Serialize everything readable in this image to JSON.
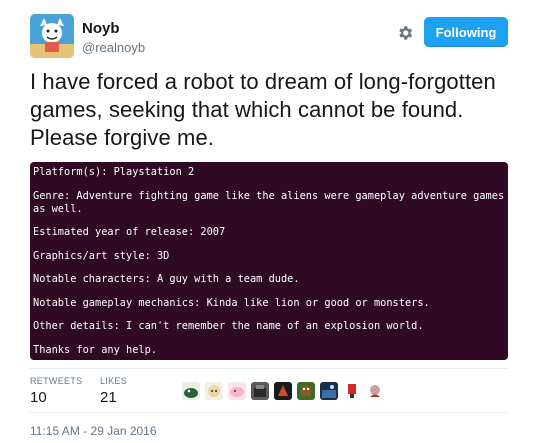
{
  "account": {
    "display_name": "Noyb",
    "handle": "@realnoyb"
  },
  "follow_button": {
    "label": "Following"
  },
  "tweet": {
    "text": "I have forced a robot to dream of long-forgotten games, seeking that which cannot be found. Please forgive me.",
    "terminal_lines": [
      "Platform(s): Playstation 2",
      "Genre: Adventure fighting game like the aliens were gameplay adventure games as well.",
      "Estimated year of release: 2007",
      "Graphics/art style: 3D",
      "Notable characters: A guy with a team dude.",
      "Notable gameplay mechanics: Kinda like lion or good or monsters.",
      "Other details: I can't remember the name of an explosion world.",
      "Thanks for any help."
    ]
  },
  "stats": {
    "retweets_label": "RETWEETS",
    "retweets_value": "10",
    "likes_label": "LIKES",
    "likes_value": "21"
  },
  "timestamp": "11:15 AM - 29 Jan 2016",
  "colors": {
    "accent": "#1da1f2",
    "terminal_bg": "#300a24"
  }
}
